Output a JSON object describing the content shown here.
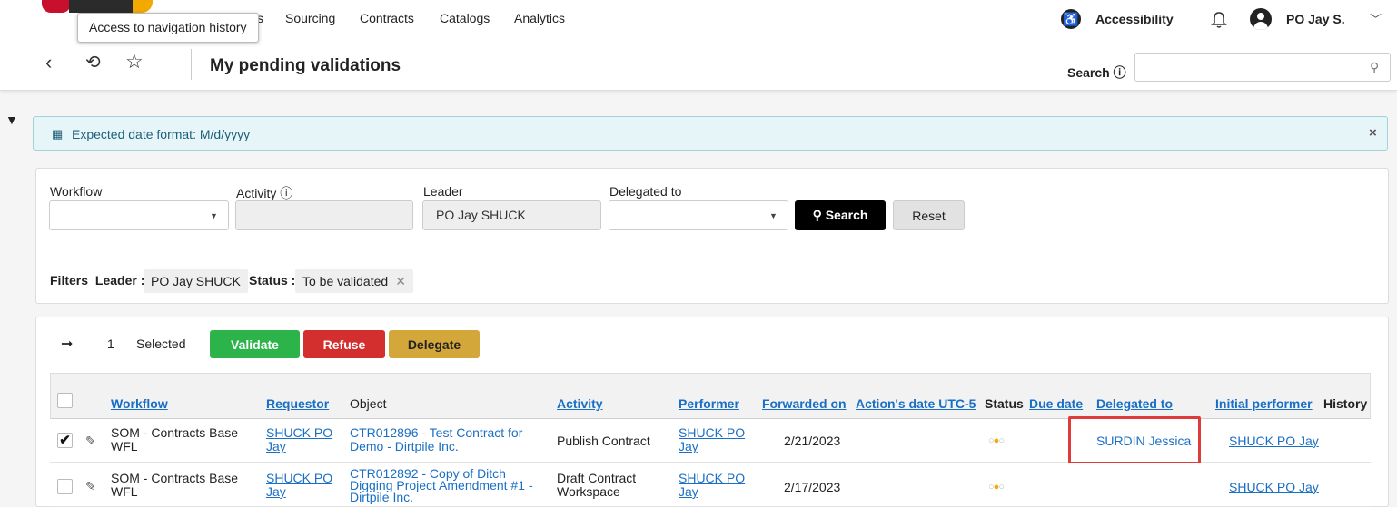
{
  "colors": {
    "brand_red": "#c8102e",
    "brand_dark": "#2b2b2b",
    "brand_yellow": "#f2a900",
    "link": "#1a6fc4",
    "validate": "#2cb34a",
    "refuse": "#d32f2f",
    "delegate": "#d4a73a",
    "highlight": "#e03b3b"
  },
  "tooltip": {
    "text": "Access to navigation history"
  },
  "topnav": {
    "fragment": "s",
    "items": [
      "Sourcing",
      "Contracts",
      "Catalogs",
      "Analytics"
    ],
    "accessibility": "Accessibility",
    "user": "PO Jay S."
  },
  "icons": {
    "accessibility": "accessibility-icon",
    "notifications": "bell-icon",
    "user": "user-avatar-icon",
    "back": "chevron-left-icon",
    "history": "history-icon",
    "favorite": "star-icon",
    "search": "search-icon",
    "filter": "filter-icon",
    "calendar": "calendar-icon",
    "close": "close-icon"
  },
  "subheader": {
    "title": "My pending validations",
    "search_label": "Search ⓘ",
    "search_value": ""
  },
  "info": {
    "text": "Expected date format: M/d/yyyy",
    "close": "×"
  },
  "filter_form": {
    "workflow_label": "Workflow",
    "workflow_value": "",
    "activity_label": "Activity ⓘ",
    "activity_value": "",
    "leader_label": "Leader",
    "leader_value": "PO Jay SHUCK",
    "delegated_label": "Delegated to",
    "delegated_value": "",
    "search_button": "Search",
    "reset_button": "Reset"
  },
  "active_filters": {
    "label": "Filters",
    "leader_label": "Leader :",
    "leader_value": "PO Jay SHUCK",
    "status_label": "Status :",
    "status_value": "To be validated"
  },
  "actions": {
    "selected_count": "1",
    "selected_label": "Selected",
    "validate": "Validate",
    "refuse": "Refuse",
    "delegate": "Delegate"
  },
  "table": {
    "columns": [
      "Workflow",
      "Requestor",
      "Object",
      "Activity",
      "Performer",
      "Forwarded on",
      "Action's date UTC-5",
      "Status",
      "Due date",
      "Delegated to",
      "Initial performer",
      "History"
    ],
    "rows": [
      {
        "checked": true,
        "workflow": [
          "SOM - Contracts Base",
          "WFL"
        ],
        "requestor": [
          "SHUCK PO",
          "Jay"
        ],
        "object": [
          "CTR012896 - Test Contract for",
          "Demo - Dirtpile Inc."
        ],
        "activity": "Publish Contract",
        "performer": [
          "SHUCK PO",
          "Jay"
        ],
        "forwarded": "2/21/2023",
        "delegated": "SURDIN Jessica",
        "initial": "SHUCK PO Jay"
      },
      {
        "checked": false,
        "workflow": [
          "SOM - Contracts Base",
          "WFL"
        ],
        "requestor": [
          "SHUCK PO",
          "Jay"
        ],
        "object": [
          "CTR012892 - Copy of Ditch",
          "Digging Project Amendment #1 -",
          "Dirtpile Inc."
        ],
        "activity": [
          "Draft Contract",
          "Workspace"
        ],
        "performer": [
          "SHUCK PO",
          "Jay"
        ],
        "forwarded": "2/17/2023",
        "delegated": "",
        "initial": "SHUCK PO Jay"
      }
    ]
  }
}
